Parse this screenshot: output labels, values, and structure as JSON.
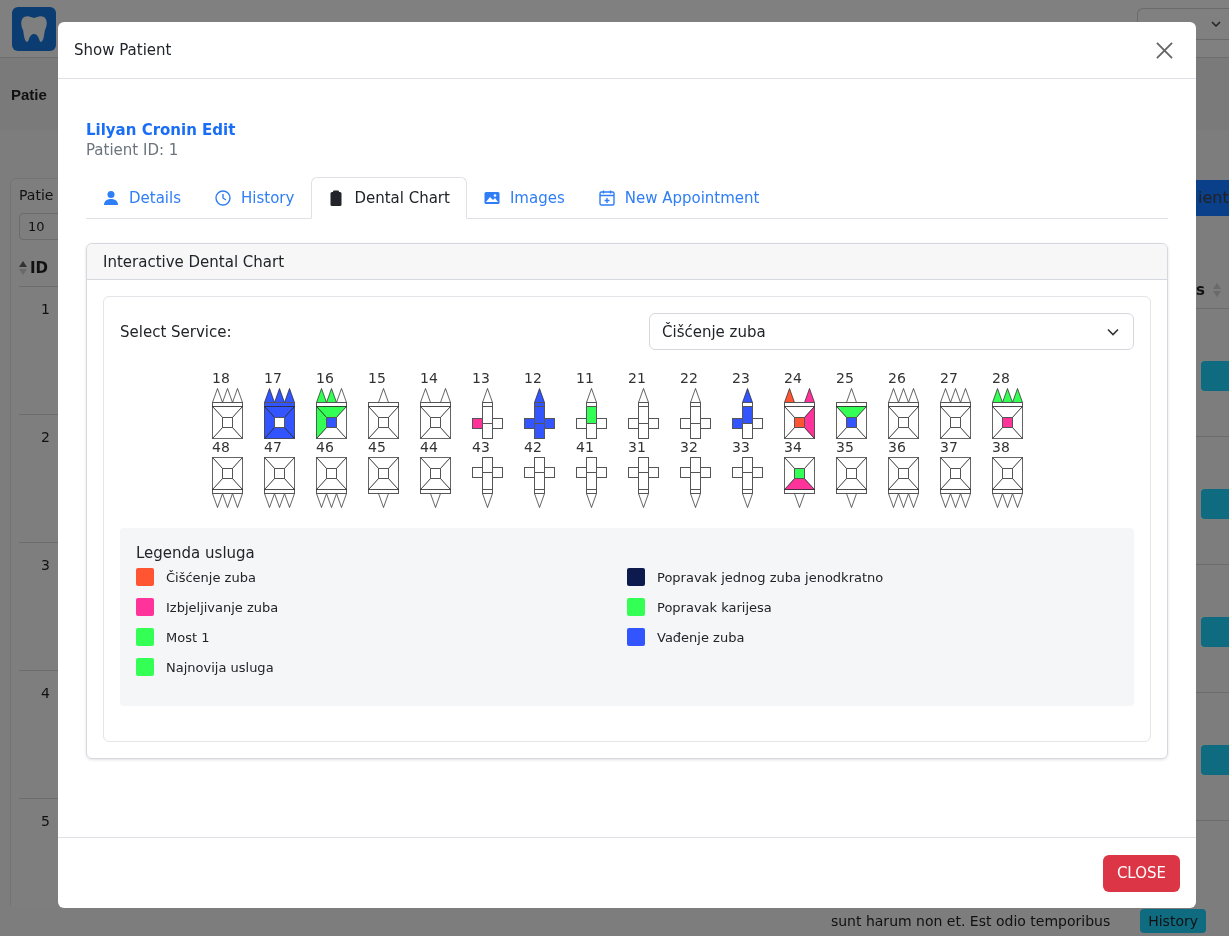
{
  "background": {
    "page_title": "Patie",
    "card_label": "Patie",
    "page_size": "10",
    "id_header": "ID",
    "last_header": "s",
    "add_button": "ient",
    "rows": [
      {
        "id": "1"
      },
      {
        "id": "2"
      },
      {
        "id": "3"
      },
      {
        "id": "4"
      },
      {
        "id": "5"
      }
    ],
    "bottom_text": "sunt harum non et. Est odio temporibus",
    "history_button": "History"
  },
  "modal": {
    "title": "Show Patient",
    "patient_name": "Lilyan Cronin Edit",
    "patient_id": "Patient ID: 1",
    "tabs": [
      {
        "label": "Details",
        "selected": false
      },
      {
        "label": "History",
        "selected": false
      },
      {
        "label": "Dental Chart",
        "selected": true
      },
      {
        "label": "Images",
        "selected": false
      },
      {
        "label": "New Appointment",
        "selected": false
      }
    ],
    "chart": {
      "title": "Interactive Dental Chart",
      "service_label": "Select Service:",
      "service_value": "Čišćenje zuba",
      "teeth_upper": [
        {
          "number": "18",
          "kind": "molar"
        },
        {
          "number": "17",
          "kind": "molar",
          "fills": {
            "cusp_1": {
              "color": "#3355ff"
            },
            "cusp_2": {
              "color": "#3355ff"
            },
            "cusp_3": {
              "color": "#3355ff"
            },
            "band": {
              "color": "#3355ff"
            },
            "inner": {
              "color": "#3355ff"
            },
            "outer": {
              "color": "#3355ff"
            },
            "left": {
              "color": "#3355ff"
            },
            "right": {
              "color": "#3355ff"
            }
          }
        },
        {
          "number": "16",
          "kind": "molar",
          "fills": {
            "cusp_1": {
              "color": "#33ff55"
            },
            "cusp_2": {
              "color": "#33ff55"
            },
            "inner": {
              "color": "#33ff55"
            },
            "left": {
              "color": "#33ff55"
            },
            "center": {
              "color": "#3355ff"
            }
          }
        },
        {
          "number": "15",
          "kind": "premolar-single"
        },
        {
          "number": "14",
          "kind": "premolar-double"
        },
        {
          "number": "13",
          "kind": "incisor",
          "fills": {
            "left": {
              "color": "#ff3399"
            }
          }
        },
        {
          "number": "12",
          "kind": "incisor",
          "fills": {
            "cusp_1": {
              "color": "#3355ff"
            },
            "band": {
              "color": "#3355ff"
            },
            "inner": {
              "color": "#3355ff"
            },
            "outer": {
              "color": "#3355ff"
            },
            "left": {
              "color": "#3355ff"
            },
            "right": {
              "color": "#3355ff"
            }
          }
        },
        {
          "number": "11",
          "kind": "incisor",
          "fills": {
            "inner": {
              "color": "#33ff55"
            }
          }
        },
        {
          "number": "21",
          "kind": "incisor"
        },
        {
          "number": "22",
          "kind": "incisor"
        },
        {
          "number": "23",
          "kind": "incisor",
          "fills": {
            "cusp_1": {
              "color": "#3355ff"
            },
            "inner": {
              "color": "#3355ff"
            },
            "left": {
              "color": "#3355ff"
            }
          }
        },
        {
          "number": "24",
          "kind": "premolar-double",
          "fills": {
            "cusp_1": {
              "color": "#ff5533"
            },
            "cusp_2": {
              "color": "#ff3399"
            },
            "center": {
              "color": "#ff5533"
            },
            "right": {
              "color": "#ff3399"
            }
          }
        },
        {
          "number": "25",
          "kind": "premolar-single",
          "fills": {
            "inner": {
              "color": "#33ff55"
            },
            "center": {
              "color": "#3355ff"
            }
          }
        },
        {
          "number": "26",
          "kind": "molar"
        },
        {
          "number": "27",
          "kind": "molar"
        },
        {
          "number": "28",
          "kind": "molar",
          "fills": {
            "cusp_1": {
              "color": "#33ff55"
            },
            "cusp_2": {
              "color": "#33ff55"
            },
            "cusp_3": {
              "color": "#33ff55"
            },
            "center": {
              "color": "#ff3399"
            }
          }
        }
      ],
      "teeth_lower": [
        {
          "number": "48",
          "kind": "molar"
        },
        {
          "number": "47",
          "kind": "molar"
        },
        {
          "number": "46",
          "kind": "molar"
        },
        {
          "number": "45",
          "kind": "premolar-single"
        },
        {
          "number": "44",
          "kind": "premolar-single"
        },
        {
          "number": "43",
          "kind": "incisor"
        },
        {
          "number": "42",
          "kind": "incisor"
        },
        {
          "number": "41",
          "kind": "incisor"
        },
        {
          "number": "31",
          "kind": "incisor"
        },
        {
          "number": "32",
          "kind": "incisor"
        },
        {
          "number": "33",
          "kind": "incisor"
        },
        {
          "number": "34",
          "kind": "premolar-single",
          "fills": {
            "center": {
              "color": "#33ff55"
            },
            "inner": {
              "color": "#ff3399"
            }
          }
        },
        {
          "number": "35",
          "kind": "premolar-single"
        },
        {
          "number": "36",
          "kind": "molar"
        },
        {
          "number": "37",
          "kind": "molar"
        },
        {
          "number": "38",
          "kind": "molar"
        }
      ],
      "legend_title": "Legenda usluga",
      "legend": [
        {
          "label": "Čišćenje zuba",
          "color": "#ff5533"
        },
        {
          "label": "Izbjeljivanje zuba",
          "color": "#ff3399"
        },
        {
          "label": "Most 1",
          "color": "#33ff55"
        },
        {
          "label": "Najnovija usluga",
          "color": "#33ff55"
        },
        {
          "label": "Popravak jednog zuba jenodkratno",
          "color": "#0d1a4d"
        },
        {
          "label": "Popravak karijesa",
          "color": "#33ff55"
        },
        {
          "label": "Vađenje zuba",
          "color": "#3355ff"
        }
      ]
    },
    "close_button": "CLOSE"
  }
}
